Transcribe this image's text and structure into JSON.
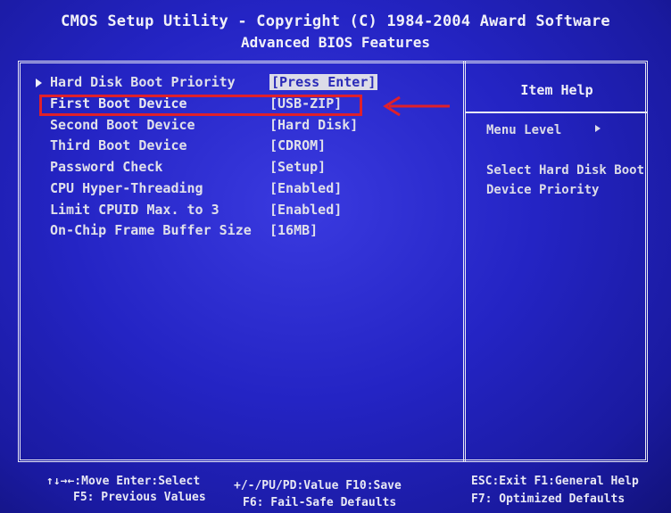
{
  "header": {
    "title": "CMOS Setup Utility - Copyright (C) 1984-2004 Award Software",
    "subtitle": "Advanced BIOS Features"
  },
  "items": [
    {
      "label": "Hard Disk Boot Priority",
      "value": "[Press Enter]"
    },
    {
      "label": "First Boot Device",
      "value": "[USB-ZIP]"
    },
    {
      "label": "Second Boot Device",
      "value": "[Hard Disk]"
    },
    {
      "label": "Third Boot Device",
      "value": "[CDROM]"
    },
    {
      "label": "Password Check",
      "value": "[Setup]"
    },
    {
      "label": "CPU Hyper-Threading",
      "value": "[Enabled]"
    },
    {
      "label": "Limit CPUID Max. to 3",
      "value": "[Enabled]"
    },
    {
      "label": "On-Chip Frame Buffer Size",
      "value": "[16MB]"
    }
  ],
  "help": {
    "title": "Item Help",
    "menu_level": "Menu Level",
    "description": "Select Hard Disk Boot Device Priority"
  },
  "footer": {
    "l1a": "↑↓→←:Move  Enter:Select",
    "l1b": "+/-/PU/PD:Value  F10:Save",
    "l1c": "ESC:Exit  F1:General Help",
    "l2a": "F5: Previous Values",
    "l2b": "F6: Fail-Safe Defaults",
    "l2c": "F7: Optimized Defaults"
  },
  "colors": {
    "background": "#2424c4",
    "text": "#e0e0ea",
    "highlight_box": "#e0202a"
  }
}
